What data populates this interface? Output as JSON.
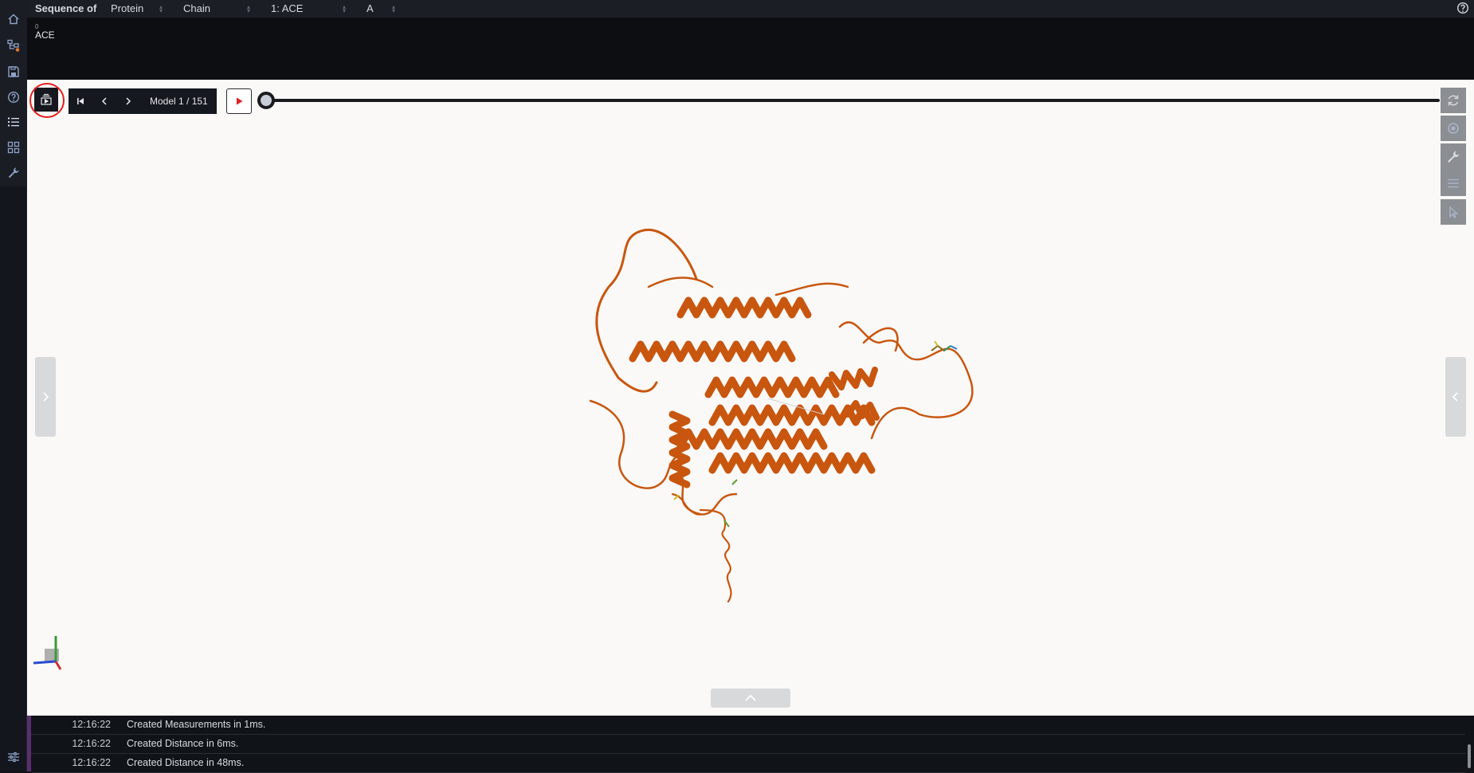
{
  "sequence": {
    "header_label": "Sequence of",
    "entity_type": "Protein",
    "chain_mode": "Chain",
    "entity": "1: ACE",
    "chain": "A",
    "residue_index": "0",
    "residue": "ACE"
  },
  "player": {
    "model_label": "Model 1 / 151",
    "current_model": 1,
    "total_models": 151
  },
  "log": [
    {
      "time": "12:16:22",
      "message": "Created Measurements in 1ms."
    },
    {
      "time": "12:16:22",
      "message": "Created Distance in 6ms."
    },
    {
      "time": "12:16:22",
      "message": "Created Distance in 48ms."
    }
  ],
  "colors": {
    "protein": "#c8560f",
    "highlight_ring": "#e0201c",
    "play_icon": "#e02020",
    "viewport_bg": "#fbf9f7"
  },
  "icons": {
    "left_toolbar": [
      "home-icon",
      "state-tree-icon",
      "save-icon",
      "help-icon",
      "list-icon",
      "grid-icon",
      "wrench-icon",
      "settings-sliders-icon"
    ],
    "right_toolbar": [
      "reset-camera-icon",
      "screenshot-icon",
      "wrench-icon",
      "controls-icon",
      "selection-icon"
    ]
  }
}
